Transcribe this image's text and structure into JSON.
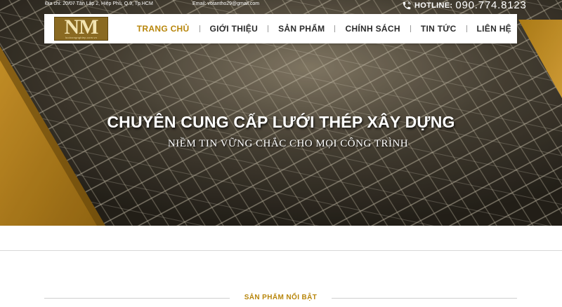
{
  "topbar": {
    "address": "Địa chỉ: 20/07 Tân Lập 2, Hiệp Phú,  Q.9, Tp.HCM",
    "email": "Email: votantho29@gmail.com",
    "hotline_label": "HOTLINE:",
    "hotline_number": "090.774.8123",
    "icon": "phone-icon"
  },
  "logo": {
    "letters": "NM",
    "domain": "luoicongnghiep.com.vn"
  },
  "nav": {
    "items": [
      {
        "label": "TRANG CHỦ",
        "active": true
      },
      {
        "label": "GIỚI THIỆU",
        "active": false
      },
      {
        "label": "SẢN PHẨM",
        "active": false
      },
      {
        "label": "CHÍNH SÁCH",
        "active": false
      },
      {
        "label": "TIN TỨC",
        "active": false
      },
      {
        "label": "LIÊN HỆ",
        "active": false
      }
    ]
  },
  "hero": {
    "title": "CHUYÊN CUNG CẤP LƯỚI THÉP XÂY DỰNG",
    "subtitle": "NIỀM TIN VỮNG CHẮC CHO MỌI CÔNG TRÌNH"
  },
  "featured": {
    "title": "SẢN PHẨM NỔI BẬT"
  },
  "colors": {
    "accent": "#b8860b",
    "hero_dark": "#2e2a22",
    "gold": "#c08a1e",
    "text_dark": "#2b2b2b"
  }
}
